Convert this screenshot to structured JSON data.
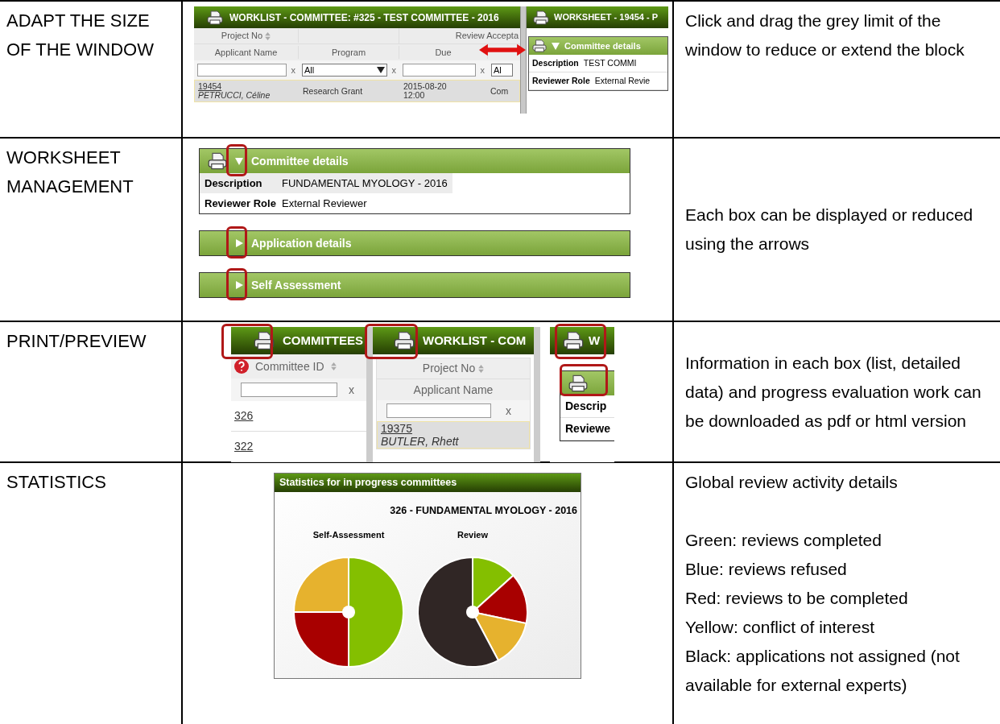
{
  "rows": [
    {
      "kind": "resize",
      "label": "ADAPT THE SIZE OF THE WINDOW",
      "description": [
        "Click and drag the grey limit of the window to reduce or extend the block"
      ],
      "worklist": {
        "title": "WORKLIST - COMMITTEE: #325 -  TEST COMMITTEE - 2016",
        "header_top": [
          "Project No",
          "Review Accepta"
        ],
        "header_bottom": [
          "Applicant Name",
          "Program",
          "Due"
        ],
        "filters": [
          {
            "kind": "text",
            "clear": "x"
          },
          {
            "kind": "select",
            "value": "All",
            "clear": "x"
          },
          {
            "kind": "text",
            "clear": "x"
          },
          {
            "kind": "select",
            "value": "Al"
          }
        ],
        "row": {
          "project_no": "19454",
          "applicant": "PETRUCCI, Céline",
          "program": "Research Grant",
          "due_date": "2015-08-20",
          "due_time": "12:00",
          "column_4": "Com"
        }
      },
      "worksheet": {
        "title": "WORKSHEET - 19454 - P",
        "section": "Committee details",
        "fields": [
          {
            "label": "Description",
            "value": "TEST COMMI"
          },
          {
            "label": "Reviewer Role",
            "value": "External Revie"
          }
        ]
      }
    },
    {
      "kind": "sections",
      "label": "WORKSHEET MANAGEMENT",
      "description": [
        "Each box can be displayed or reduced using the arrows"
      ],
      "sections": [
        {
          "title": "Committee details",
          "expanded": true,
          "printable": true,
          "fields": [
            {
              "label": "Description",
              "value": "FUNDAMENTAL MYOLOGY - 2016"
            },
            {
              "label": "Reviewer Role",
              "value": "External Reviewer"
            }
          ]
        },
        {
          "title": "Application details",
          "expanded": false,
          "printable": false
        },
        {
          "title": "Self Assessment",
          "expanded": false,
          "printable": false
        }
      ]
    },
    {
      "kind": "print",
      "label": "PRINT/PREVIEW",
      "description": [
        "Information in each box (list, detailed data) and progress evaluation work can be downloaded as pdf or html version"
      ],
      "panels": [
        {
          "kind": "committees",
          "title": "COMMITTEES",
          "header": "Committee ID",
          "clear": "x",
          "links": [
            "326",
            "322"
          ]
        },
        {
          "kind": "worklist",
          "title": "WORKLIST - COM",
          "headers": [
            "Project No",
            "Applicant Name"
          ],
          "clear": "x",
          "project_no": "19375",
          "applicant": "BUTLER, Rhett"
        },
        {
          "kind": "worksheet",
          "title": "W",
          "fields": [
            "Descrip",
            "Reviewe"
          ]
        }
      ]
    },
    {
      "kind": "stats",
      "label": "STATISTICS",
      "description": [
        "Global review activity details",
        "Green: reviews completed",
        "Blue: reviews refused",
        "Red: reviews to be completed",
        "Yellow: conflict of interest",
        "Black: applications not assigned (not available for external experts)"
      ],
      "stats": {
        "title": "Statistics for in progress committees",
        "heading": "326 - FUNDAMENTAL MYOLOGY - 2016",
        "charts": [
          "Self-Assessment",
          "Review"
        ]
      }
    }
  ]
}
